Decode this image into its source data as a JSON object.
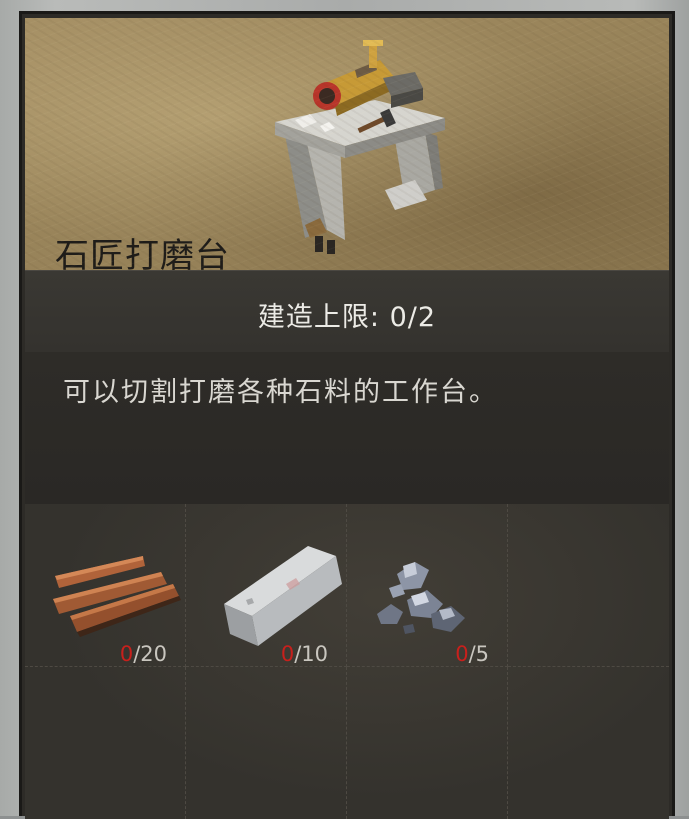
{
  "item": {
    "name": "石匠打磨台",
    "build_limit_label": "建造上限",
    "build_limit_value": "0/2",
    "description": "可以切割打磨各种石料的工作台。"
  },
  "materials": [
    {
      "name": "wood-planks",
      "have": "0",
      "need": "/20"
    },
    {
      "name": "stone-block",
      "have": "0",
      "need": "/10"
    },
    {
      "name": "iron-ore",
      "have": "0",
      "need": "/5"
    }
  ],
  "colors": {
    "header_bg": "#9a855b",
    "panel_bg": "#2d2b27",
    "count_missing": "#c8201c",
    "count_text": "#c9c6bf"
  }
}
